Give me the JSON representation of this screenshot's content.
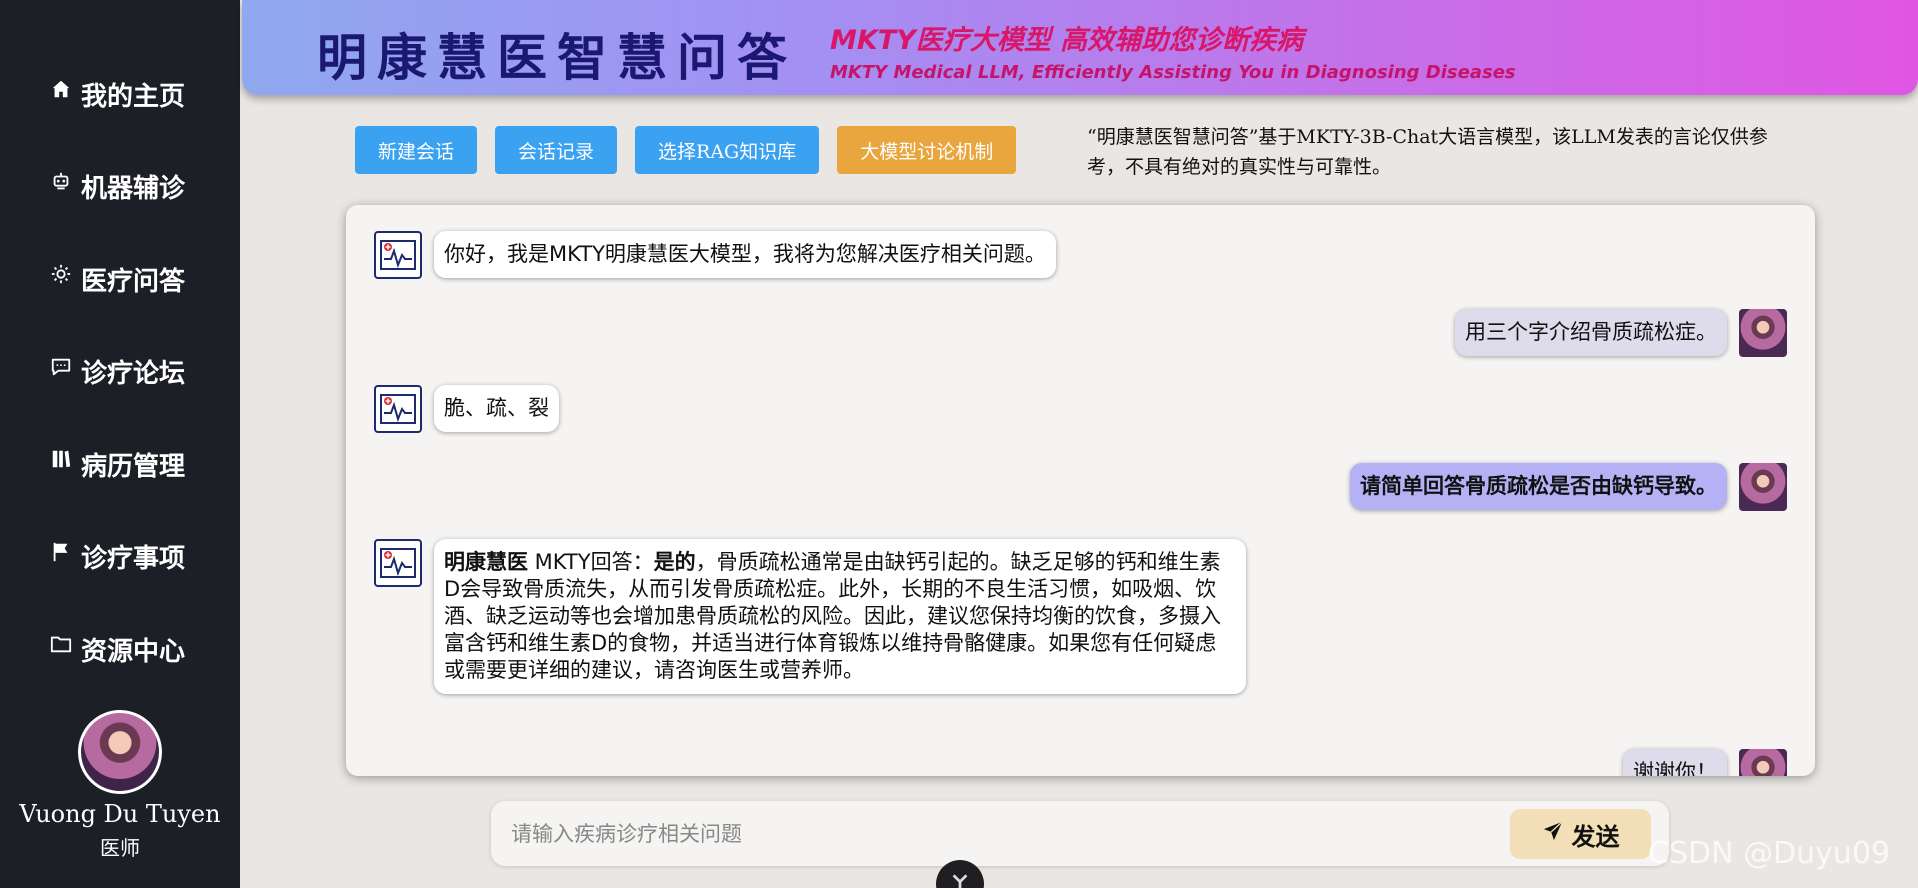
{
  "sidebar": {
    "items": [
      {
        "label": "我的主页",
        "icon": "home-icon"
      },
      {
        "label": "机器辅诊",
        "icon": "robot-icon"
      },
      {
        "label": "医疗问答",
        "icon": "bulb-icon"
      },
      {
        "label": "诊疗论坛",
        "icon": "chat-icon"
      },
      {
        "label": "病历管理",
        "icon": "book-icon"
      },
      {
        "label": "诊疗事项",
        "icon": "flag-icon"
      },
      {
        "label": "资源中心",
        "icon": "folder-icon"
      }
    ],
    "user": {
      "name": "Vuong Du Tuyen",
      "role": "医师"
    }
  },
  "header": {
    "title": "明康慧医智慧问答",
    "subtitle_cn": "MKTY医疗大模型 高效辅助您诊断疾病",
    "subtitle_en": "MKTY Medical LLM, Efficiently Assisting You in Diagnosing Diseases"
  },
  "toolbar": {
    "new_chat": "新建会话",
    "history": "会话记录",
    "rag": "选择RAG知识库",
    "discussion": "大模型讨论机制",
    "disclaimer": "“明康慧医智慧问答”基于MKTY-3B-Chat大语言模型，该LLM发表的言论仅供参考，不具有绝对的真实性与可靠性。"
  },
  "chat": {
    "messages": [
      {
        "role": "bot",
        "text": "你好，我是MKTY明康慧医大模型，我将为您解决医疗相关问题。"
      },
      {
        "role": "user",
        "text": "用三个字介绍骨质疏松症。"
      },
      {
        "role": "bot",
        "text": "脆、疏、裂"
      },
      {
        "role": "user",
        "text": "请简单回答骨质疏松是否由缺钙导致。"
      },
      {
        "role": "bot",
        "prefix_bold": "明康慧医",
        "prefix": " MKTY回答：",
        "answer_bold": "是的",
        "body": "，骨质疏松通常是由缺钙引起的。缺乏足够的钙和维生素D会导致骨质流失，从而引发骨质疏松症。此外，长期的不良生活习惯，如吸烟、饮酒、缺乏运动等也会增加患骨质疏松的风险。因此，建议您保持均衡的饮食，多摄入富含钙和维生素D的食物，并适当进行体育锻炼以维持骨骼健康。如果您有任何疑虑或需要更详细的建议，请咨询医生或营养师。"
      },
      {
        "role": "user",
        "text": "谢谢你！"
      }
    ]
  },
  "input": {
    "placeholder": "请输入疾病诊疗相关问题",
    "value": "",
    "send_label": "发送"
  },
  "watermark": "CSDN @Duyu09",
  "colors": {
    "sidebar_bg": "#1d1f27",
    "banner_title": "#1a1870",
    "banner_subtitle": "#d8176a",
    "button_blue": "#3aa2f0",
    "button_orange": "#e9a53e",
    "send_button": "#f2dfb8"
  }
}
